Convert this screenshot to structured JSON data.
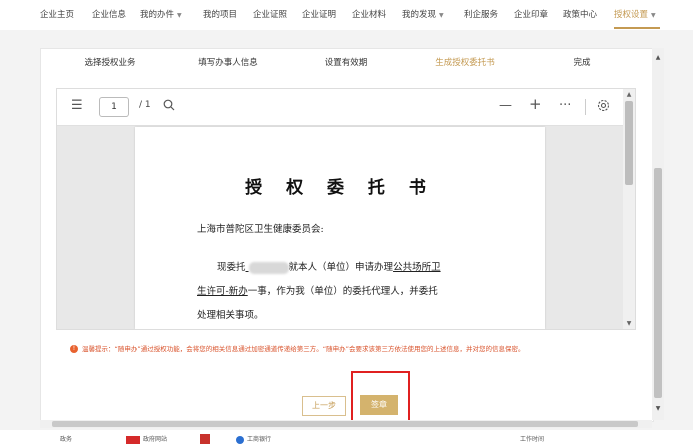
{
  "nav": {
    "items": [
      {
        "label": "企业主页",
        "caret": false
      },
      {
        "label": "企业信息",
        "caret": false
      },
      {
        "label": "我的办件",
        "caret": true
      },
      {
        "label": "我的项目",
        "caret": false
      },
      {
        "label": "企业证照",
        "caret": false
      },
      {
        "label": "企业证明",
        "caret": false
      },
      {
        "label": "企业材料",
        "caret": false
      },
      {
        "label": "我的发现",
        "caret": true
      },
      {
        "label": "利企服务",
        "caret": false
      },
      {
        "label": "企业印章",
        "caret": false
      },
      {
        "label": "政策中心",
        "caret": false
      },
      {
        "label": "授权设置",
        "caret": true,
        "active": true
      }
    ],
    "accent": "#c49a52"
  },
  "steps": [
    "选择授权业务",
    "填写办事人信息",
    "设置有效期",
    "生成授权委托书",
    "完成"
  ],
  "active_step": 3,
  "viewer": {
    "page_current": "1",
    "page_total": "/ 1",
    "icons": [
      "sidebar-toggle-icon",
      "search-icon",
      "zoom-out-icon",
      "zoom-in-icon",
      "more-icon",
      "settings-icon"
    ]
  },
  "document": {
    "title": "授 权 委 托 书",
    "recipient": "上海市普陀区卫生健康委员会:",
    "line1_prefix": "现委托",
    "line1_mid": "就本人（单位）申请办理",
    "line1_service": "公共场所卫",
    "line2_service": "生许可-新办",
    "line2_rest": "一事，作为我（单位）的委托代理人，并委托",
    "line3": "处理相关事项。"
  },
  "tip": {
    "text": "温馨提示：“随申办”通过授权功能，会将您的相关信息通过加密通道传递给第三方。“随申办”会要求该第三方依法使用您的上述信息，并对您的信息保密。"
  },
  "buttons": {
    "prev": "上一步",
    "sign": "签章"
  },
  "footer": {
    "items": [
      "政务",
      "政府网站",
      "工商银行",
      "工作时间"
    ]
  }
}
